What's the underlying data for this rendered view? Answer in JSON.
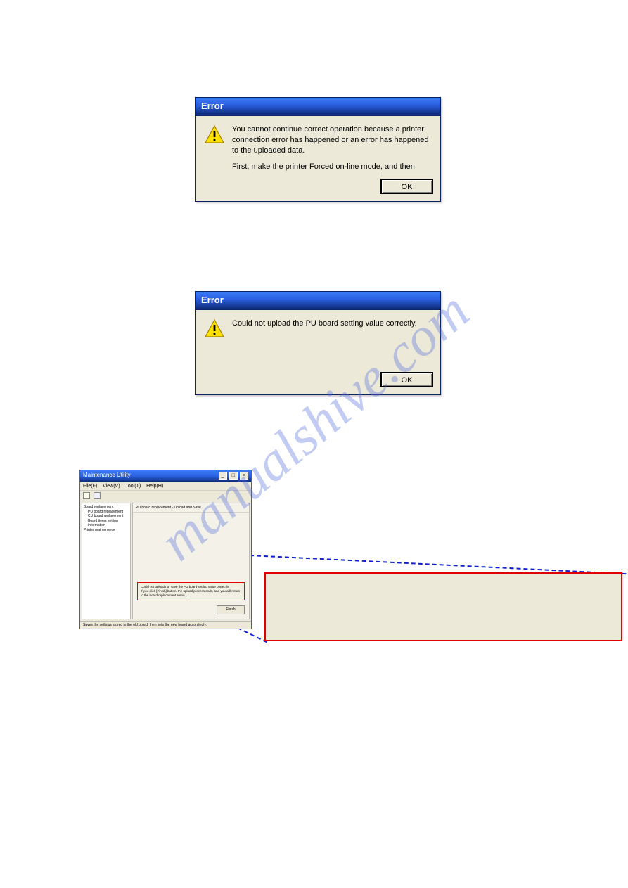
{
  "watermark": "manualshive.com",
  "dialog1": {
    "title": "Error",
    "line1": "You cannot continue correct operation because a printer connection error has happened or an error has happened to the uploaded data.",
    "line2": "First, make the printer Forced on-line mode, and then",
    "ok": "OK"
  },
  "dialog2": {
    "title": "Error",
    "msg": "Could not upload the PU board setting value correctly.",
    "ok": "OK"
  },
  "appwindow": {
    "title": "Maintenance Utility",
    "menu": {
      "file": "File(F)",
      "view": "View(V)",
      "tool": "Tool(T)",
      "help": "Help(H)"
    },
    "tree": {
      "root": "Board replacement",
      "items": [
        "PU board replacement",
        "CU board replacement",
        "Board items setting information"
      ],
      "root2": "Printer maintenance"
    },
    "panel_title": "PU board replacement - Upload and Save",
    "msg_line1": "Could not upload nor save the PU board setting value correctly.",
    "msg_line2": "If you click [Finish] button, the upload process ends, and you will return to the board replacement Menu.]",
    "finish": "Finish",
    "status": "Saves the settings stored in the old board, then sets the new board accordingly."
  }
}
